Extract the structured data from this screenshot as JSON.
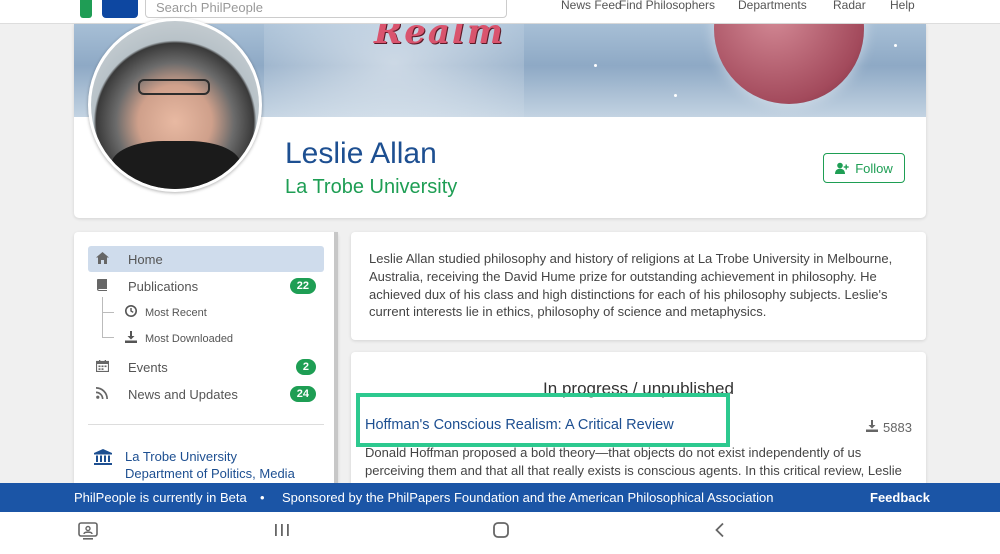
{
  "topnav": {
    "search_placeholder": "Search PhilPeople",
    "links": [
      "News Feed",
      "Find Philosophers",
      "Departments",
      "Radar",
      "Help"
    ]
  },
  "banner": {
    "title_text": "Realm"
  },
  "profile": {
    "name": "Leslie Allan",
    "affiliation": "La Trobe University",
    "follow_label": "Follow"
  },
  "sidebar": {
    "items": [
      {
        "label": "Home",
        "icon": "home-icon",
        "badge": ""
      },
      {
        "label": "Publications",
        "icon": "book-icon",
        "badge": "22"
      },
      {
        "label": "Events",
        "icon": "calendar-icon",
        "badge": "2"
      },
      {
        "label": "News and Updates",
        "icon": "rss-icon",
        "badge": "24"
      }
    ],
    "sub_items": [
      {
        "label": "Most Recent",
        "icon": "clock-icon"
      },
      {
        "label": "Most Downloaded",
        "icon": "download-icon"
      }
    ],
    "institution": {
      "line1": "La Trobe University",
      "line2": "Department of Politics, Media"
    }
  },
  "bio": {
    "text": "Leslie Allan studied philosophy and history of religions at La Trobe University in Melbourne, Australia, receiving the David Hume prize for outstanding achievement in philosophy. He achieved dux of his class and high distinctions for each of his philosophy subjects. Leslie's current interests lie in ethics, philosophy of science and metaphysics."
  },
  "publications": {
    "heading": "In progress / unpublished",
    "items": [
      {
        "title": "Hoffman's Conscious Realism: A Critical Review",
        "downloads": "5883",
        "abstract": "Donald Hoffman proposed a bold theory—that objects do not exist independently of us perceiving them and that all that really exists is conscious agents. In this critical review, Leslie"
      }
    ]
  },
  "betabar": {
    "beta_text": "PhilPeople is currently in Beta",
    "separator": "•",
    "sponsor_text": "Sponsored by the PhilPapers Foundation and the American Philosophical Association",
    "feedback_label": "Feedback"
  },
  "colors": {
    "brand_blue": "#1d4f91",
    "brand_green": "#1e9e54",
    "beta_bar": "#1b55a6",
    "highlight": "#2dc98f"
  }
}
